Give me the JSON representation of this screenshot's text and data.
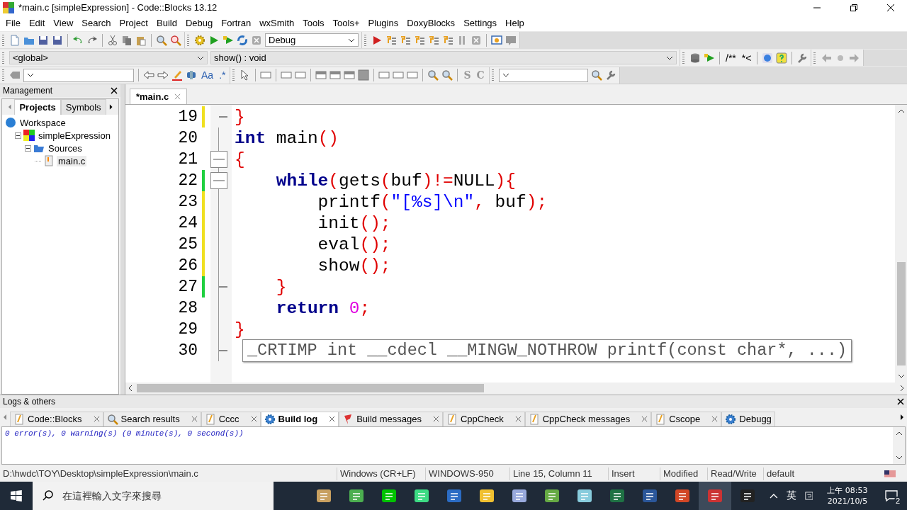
{
  "window": {
    "title": "*main.c [simpleExpression] - Code::Blocks 13.12"
  },
  "menu": [
    "File",
    "Edit",
    "View",
    "Search",
    "Project",
    "Build",
    "Debug",
    "Fortran",
    "wxSmith",
    "Tools",
    "Tools+",
    "Plugins",
    "DoxyBlocks",
    "Settings",
    "Help"
  ],
  "toolbar": {
    "build_target": "Debug",
    "scope": "<global>",
    "function": "show() : void",
    "doxy_texts": [
      "/**",
      "*<"
    ],
    "glyphs": [
      "Aa",
      ".*",
      "S",
      "C"
    ]
  },
  "management": {
    "title": "Management",
    "tabs": [
      {
        "label": "Projects",
        "selected": true
      },
      {
        "label": "Symbols",
        "selected": false
      }
    ],
    "tree": [
      {
        "label": "Workspace",
        "selected": false,
        "children": [
          {
            "label": "simpleExpression",
            "selected": false,
            "expanded": true,
            "children": [
              {
                "label": "Sources",
                "selected": false,
                "expanded": true,
                "children": [
                  {
                    "label": "main.c",
                    "selected": true,
                    "expanded": false
                  }
                ]
              }
            ]
          }
        ]
      }
    ]
  },
  "editor": {
    "tabs": [
      {
        "label": "*main.c",
        "selected": true
      }
    ],
    "lines": [
      {
        "number": "19",
        "color": "#f0e020",
        "fold_point": false,
        "fold_end": true,
        "tokens": [
          {
            "kind": "op",
            "text": "}"
          }
        ]
      },
      {
        "number": "20",
        "fold_point": false,
        "fold_end": false,
        "tokens": [
          {
            "kind": "keyword",
            "text": "int"
          },
          {
            "kind": "ident",
            "text": " main"
          },
          {
            "kind": "op",
            "text": "()"
          }
        ]
      },
      {
        "number": "21",
        "fold_point": true,
        "fold_end": false,
        "tokens": [
          {
            "kind": "op",
            "text": "{"
          }
        ]
      },
      {
        "number": "22",
        "color": "#20d040",
        "fold_point": true,
        "fold_end": false,
        "tokens": [
          {
            "kind": "keyword",
            "text": "    while"
          },
          {
            "kind": "op",
            "text": "("
          },
          {
            "kind": "ident",
            "text": "gets"
          },
          {
            "kind": "op",
            "text": "("
          },
          {
            "kind": "ident",
            "text": "buf"
          },
          {
            "kind": "op",
            "text": ")!="
          },
          {
            "kind": "ident",
            "text": "NULL"
          },
          {
            "kind": "op",
            "text": "){"
          }
        ]
      },
      {
        "number": "23",
        "color": "#f0e020",
        "fold_point": false,
        "fold_end": false,
        "tokens": [
          {
            "kind": "ident",
            "text": "        printf"
          },
          {
            "kind": "op",
            "text": "("
          },
          {
            "kind": "string",
            "text": "\"[%s]\\n\""
          },
          {
            "kind": "op",
            "text": ","
          },
          {
            "kind": "ident",
            "text": " buf"
          },
          {
            "kind": "op",
            "text": ");"
          }
        ]
      },
      {
        "number": "24",
        "color": "#f0e020",
        "fold_point": false,
        "fold_end": false,
        "tokens": [
          {
            "kind": "ident",
            "text": "        init"
          },
          {
            "kind": "op",
            "text": "();"
          }
        ]
      },
      {
        "number": "25",
        "color": "#f0e020",
        "fold_point": false,
        "fold_end": false,
        "tokens": [
          {
            "kind": "ident",
            "text": "        eval"
          },
          {
            "kind": "op",
            "text": "();"
          }
        ]
      },
      {
        "number": "26",
        "color": "#f0e020",
        "fold_point": false,
        "fold_end": false,
        "tokens": [
          {
            "kind": "ident",
            "text": "        show"
          },
          {
            "kind": "op",
            "text": "();"
          }
        ]
      },
      {
        "number": "27",
        "color": "#20d040",
        "fold_point": false,
        "fold_end": true,
        "tokens": [
          {
            "kind": "op",
            "text": "    }"
          }
        ]
      },
      {
        "number": "28",
        "fold_point": false,
        "fold_end": false,
        "tokens": [
          {
            "kind": "keyword",
            "text": "    return"
          },
          {
            "kind": "number",
            "text": " 0"
          },
          {
            "kind": "op",
            "text": ";"
          }
        ]
      },
      {
        "number": "29",
        "fold_point": false,
        "fold_end": false,
        "tokens": [
          {
            "kind": "op",
            "text": "}"
          }
        ]
      },
      {
        "number": "30",
        "fold_point": false,
        "fold_end": true
      }
    ],
    "calltip": "_CRTIMP int __cdecl __MINGW_NOTHROW printf(const char*, ...)"
  },
  "logs": {
    "title": "Logs & others",
    "tabs": [
      {
        "label": "Code::Blocks",
        "selected": false
      },
      {
        "label": "Search results",
        "selected": false
      },
      {
        "label": "Cccc",
        "selected": false
      },
      {
        "label": "Build log",
        "selected": true
      },
      {
        "label": "Build messages",
        "selected": false
      },
      {
        "label": "CppCheck",
        "selected": false
      },
      {
        "label": "CppCheck messages",
        "selected": false
      },
      {
        "label": "Cscope",
        "selected": false
      },
      {
        "label": "Debugg",
        "selected": false
      }
    ],
    "output": "0 error(s), 0 warning(s) (0 minute(s), 0 second(s))"
  },
  "status_bar": [
    "D:\\hwdc\\TOY\\Desktop\\simpleExpression\\main.c",
    "Windows (CR+LF)",
    "WINDOWS-950",
    "Line 15, Column 11",
    "Insert",
    "Modified",
    "Read/Write",
    "default"
  ],
  "taskbar": {
    "search_placeholder": "在這裡輸入文字來搜尋",
    "ime": "英",
    "time": "上午 08:53",
    "date": "2021/10/5",
    "notifications": "2"
  }
}
